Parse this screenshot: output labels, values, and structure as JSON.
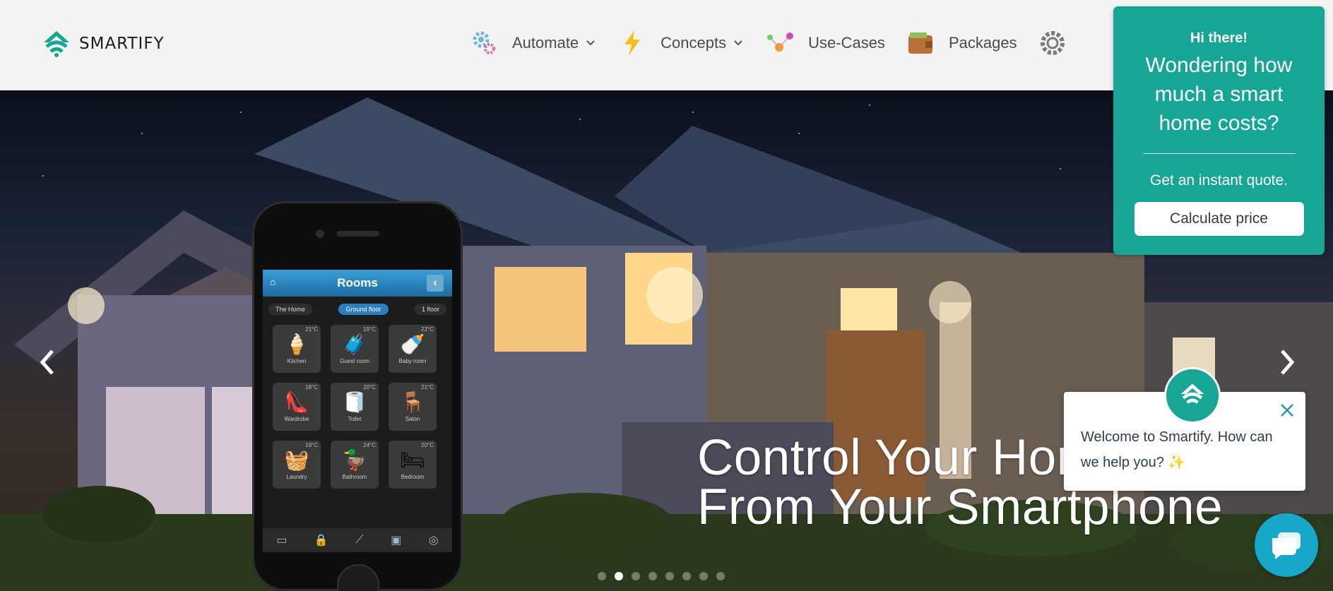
{
  "brand": {
    "name": "SMARTIFY",
    "accent": "#17a596"
  },
  "nav": {
    "items": [
      {
        "label": "Automate",
        "icon": "gears-icon",
        "dropdown": true
      },
      {
        "label": "Concepts",
        "icon": "lightning-icon",
        "dropdown": true
      },
      {
        "label": "Use-Cases",
        "icon": "network-icon",
        "dropdown": false
      },
      {
        "label": "Packages",
        "icon": "wallet-icon",
        "dropdown": false
      },
      {
        "label": "",
        "icon": "gear-icon",
        "dropdown": false
      }
    ]
  },
  "hero": {
    "caption_line1": "Control Your Hor",
    "caption_line2": "From Your Smartphone",
    "slide_count": 8,
    "active_slide": 2
  },
  "phone_app": {
    "title": "Rooms",
    "tabs": [
      "The Home",
      "Ground floor",
      "1 floor"
    ],
    "selected_tab": "Ground floor",
    "rooms": [
      {
        "name": "Kitchen",
        "temp": "21°C",
        "glyph": "🍦"
      },
      {
        "name": "Guest room",
        "temp": "19°C",
        "glyph": "🧳"
      },
      {
        "name": "Baby room",
        "temp": "22°C",
        "glyph": "🍼"
      },
      {
        "name": "Wardrobe",
        "temp": "18°C",
        "glyph": "👠"
      },
      {
        "name": "Toilet",
        "temp": "20°C",
        "glyph": "🧻"
      },
      {
        "name": "Salon",
        "temp": "21°C",
        "glyph": "🪑"
      },
      {
        "name": "Laundry",
        "temp": "19°C",
        "glyph": "🧺"
      },
      {
        "name": "Bathroom",
        "temp": "24°C",
        "glyph": "🦆"
      },
      {
        "name": "Bedroom",
        "temp": "20°C",
        "glyph": "🛏"
      }
    ]
  },
  "quote_box": {
    "greeting": "Hi there!",
    "title": "Wondering how much a smart home costs?",
    "subtitle": "Get an instant quote.",
    "button": "Calculate price"
  },
  "chat": {
    "message": "Welcome to Smartify. How can we help you? ✨"
  }
}
